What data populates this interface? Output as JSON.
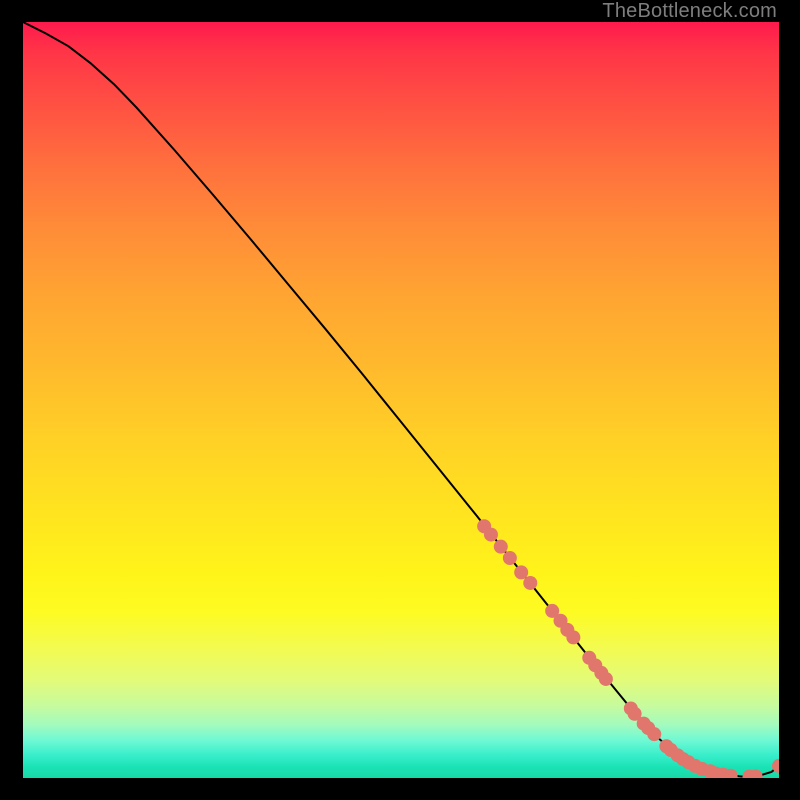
{
  "watermark": "TheBottleneck.com",
  "chart_data": {
    "type": "line",
    "title": "",
    "xlabel": "",
    "ylabel": "",
    "xlim": [
      0,
      100
    ],
    "ylim": [
      0,
      100
    ],
    "grid": false,
    "legend": false,
    "series": [
      {
        "name": "curve",
        "color": "#000000",
        "x": [
          0,
          3,
          6,
          9,
          12,
          15,
          20,
          25,
          30,
          35,
          40,
          45,
          50,
          55,
          60,
          65,
          70,
          75,
          80,
          84,
          87,
          89,
          91,
          93,
          95,
          97,
          99,
          100
        ],
        "y": [
          100,
          98.5,
          96.8,
          94.5,
          91.8,
          88.7,
          83.1,
          77.3,
          71.4,
          65.4,
          59.4,
          53.3,
          47.1,
          40.9,
          34.7,
          28.4,
          22.1,
          15.8,
          9.7,
          5.3,
          2.7,
          1.6,
          0.9,
          0.45,
          0.2,
          0.2,
          0.8,
          1.6
        ]
      }
    ],
    "markers": {
      "color": "#e0766c",
      "radius_px": 7,
      "points_xy": [
        [
          61.0,
          33.3
        ],
        [
          61.9,
          32.2
        ],
        [
          63.2,
          30.6
        ],
        [
          64.4,
          29.1
        ],
        [
          65.9,
          27.2
        ],
        [
          67.1,
          25.8
        ],
        [
          70.0,
          22.1
        ],
        [
          71.1,
          20.8
        ],
        [
          72.0,
          19.6
        ],
        [
          72.8,
          18.6
        ],
        [
          74.9,
          15.9
        ],
        [
          75.7,
          14.9
        ],
        [
          76.5,
          13.9
        ],
        [
          77.1,
          13.1
        ],
        [
          80.4,
          9.2
        ],
        [
          80.9,
          8.5
        ],
        [
          82.1,
          7.2
        ],
        [
          82.7,
          6.6
        ],
        [
          83.5,
          5.8
        ],
        [
          85.1,
          4.2
        ],
        [
          85.7,
          3.7
        ],
        [
          86.6,
          3.0
        ],
        [
          87.3,
          2.5
        ],
        [
          88.0,
          2.1
        ],
        [
          88.9,
          1.6
        ],
        [
          89.8,
          1.2
        ],
        [
          90.9,
          0.9
        ],
        [
          91.6,
          0.6
        ],
        [
          92.6,
          0.45
        ],
        [
          93.6,
          0.3
        ],
        [
          96.1,
          0.2
        ],
        [
          96.9,
          0.2
        ],
        [
          100.0,
          1.6
        ]
      ]
    }
  }
}
